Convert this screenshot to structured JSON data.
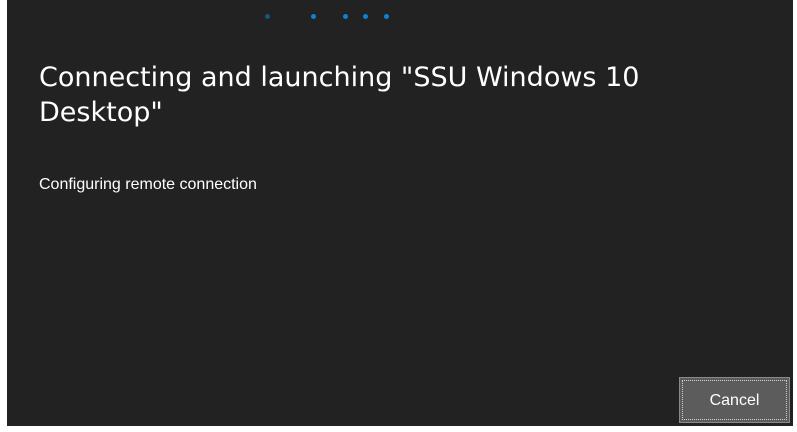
{
  "dialog": {
    "title": "Connecting and launching \"SSU Windows 10 Desktop\"",
    "status_text": "Configuring remote connection",
    "cancel_label": "Cancel"
  },
  "progress_indicator": {
    "style": "indeterminate-dots",
    "dot_count": 5,
    "color": "#0a84d6"
  },
  "colors": {
    "dialog_background": "#222222",
    "text": "#ffffff",
    "button_background": "#5c5c5c"
  }
}
